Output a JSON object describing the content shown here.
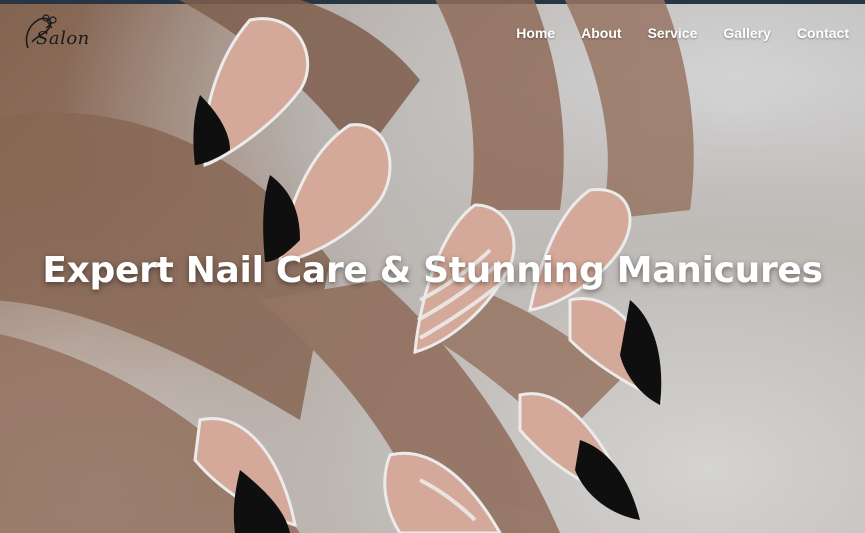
{
  "brand": {
    "logo_text": "Salon",
    "logo_icon": "scissors-icon"
  },
  "nav": {
    "items": [
      {
        "label": "Home"
      },
      {
        "label": "About"
      },
      {
        "label": "Service"
      },
      {
        "label": "Gallery"
      },
      {
        "label": "Contact"
      }
    ]
  },
  "hero": {
    "title": "Expert Nail Care & Stunning Manicures",
    "image": "hands-with-long-almond-nails-photo"
  },
  "colors": {
    "nav_text": "#ffffff",
    "title_text": "#ffffff",
    "top_strip": "#2c3a4a",
    "skin": "#9a7764",
    "nail_pink": "#e8b8a6",
    "fur": "#e6e4e2"
  }
}
